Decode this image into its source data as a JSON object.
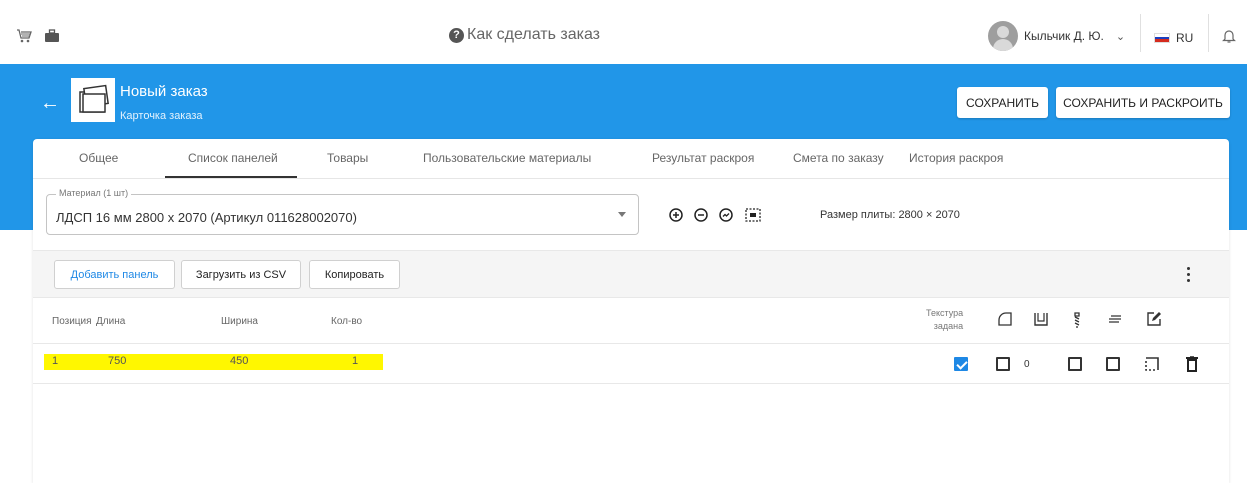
{
  "topbar": {
    "help_text": "Как сделать заказ",
    "user_name": "Кыльчик Д. Ю.",
    "language": "RU",
    "icons": [
      "cart-icon",
      "briefcase-icon",
      "help-icon",
      "chevron-down-icon",
      "russia-flag-icon",
      "bell-icon"
    ]
  },
  "header": {
    "title": "Новый заказ",
    "subtitle": "Карточка заказа",
    "save_label": "СОХРАНИТЬ",
    "save_cut_label": "СОХРАНИТЬ И РАСКРОИТЬ",
    "accent_color": "#2196e8"
  },
  "tabs": [
    {
      "label": "Общее"
    },
    {
      "label": "Список панелей",
      "active": true
    },
    {
      "label": "Товары"
    },
    {
      "label": "Пользовательские материалы"
    },
    {
      "label": "Результат раскроя"
    },
    {
      "label": "Смета по заказу"
    },
    {
      "label": "История раскроя"
    }
  ],
  "material": {
    "label": "Материал (1 шт)",
    "value": "ЛДСП 16 мм 2800 х 2070 (Артикул 011628002070)",
    "plate_size": "Размер плиты: 2800 × 2070",
    "tools": [
      "zoom-in-icon",
      "zoom-out-icon",
      "rotate-icon",
      "fit-icon"
    ]
  },
  "toolbar": {
    "add_panel": "Добавить панель",
    "load_csv": "Загрузить из CSV",
    "copy": "Копировать"
  },
  "table": {
    "columns": {
      "position": "Позиция",
      "length": "Длина",
      "width": "Ширина",
      "qty": "Кол-во",
      "texture_line1": "Текстура",
      "texture_line2": "задана"
    },
    "rows": [
      {
        "position": "1",
        "length": "750",
        "width": "450",
        "qty": "1",
        "texture": true,
        "edge_count": "0"
      }
    ],
    "highlight_color": "#fff700"
  }
}
